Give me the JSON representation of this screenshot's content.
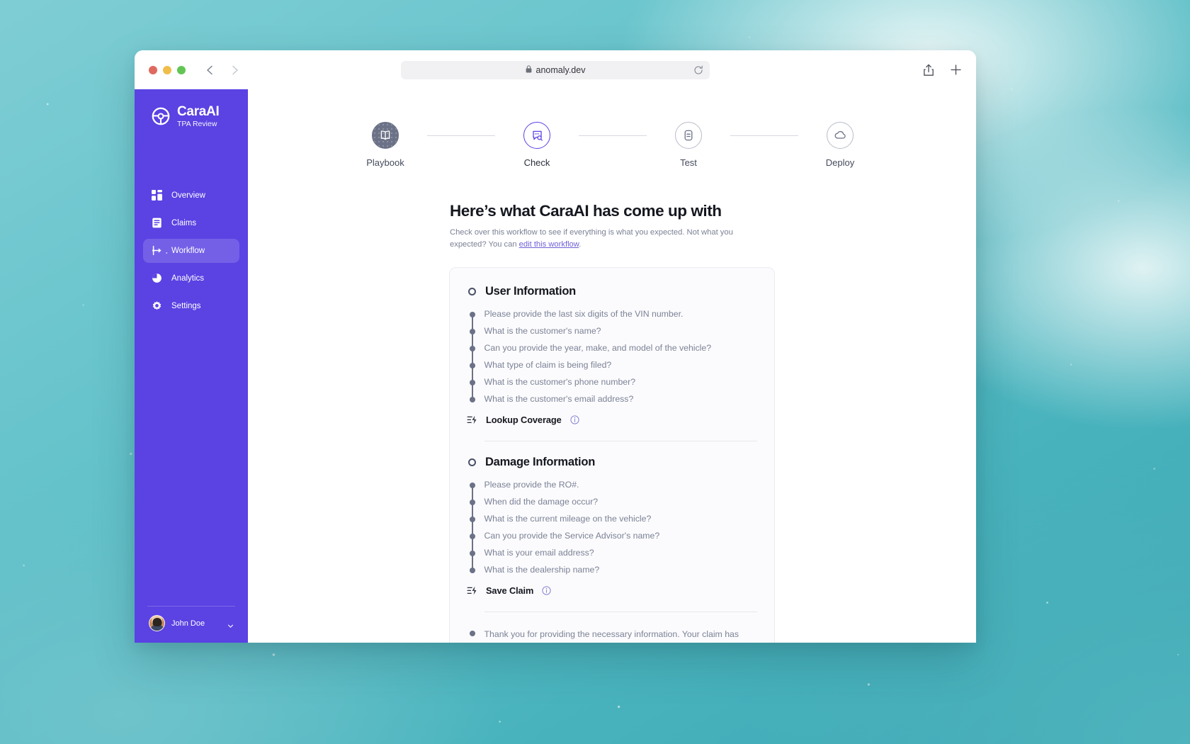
{
  "browser": {
    "url": "anomaly.dev",
    "lock_icon": "lock-icon",
    "reload_icon": "reload-icon",
    "back_icon": "chevron-left-icon",
    "forward_icon": "chevron-right-icon",
    "share_icon": "share-icon",
    "new_tab_icon": "plus-icon"
  },
  "sidebar": {
    "brand": {
      "title": "CaraAI",
      "subtitle": "TPA Review",
      "logo_icon": "steering-wheel-icon"
    },
    "items": [
      {
        "label": "Overview",
        "icon": "grid-icon",
        "active": false
      },
      {
        "label": "Claims",
        "icon": "document-icon",
        "active": false
      },
      {
        "label": "Workflow",
        "icon": "workflow-icon",
        "active": true
      },
      {
        "label": "Analytics",
        "icon": "pie-chart-icon",
        "active": false
      },
      {
        "label": "Settings",
        "icon": "gear-icon",
        "active": false
      }
    ],
    "user": {
      "name": "John Doe",
      "caret_icon": "chevron-down-icon"
    },
    "accent": "#5A42E3"
  },
  "stepper": {
    "steps": [
      {
        "label": "Playbook",
        "icon": "book-icon",
        "state": "done"
      },
      {
        "label": "Check",
        "icon": "chat-search-icon",
        "state": "current"
      },
      {
        "label": "Test",
        "icon": "test-doc-icon",
        "state": "upcoming"
      },
      {
        "label": "Deploy",
        "icon": "cloud-icon",
        "state": "upcoming"
      }
    ],
    "current_color": "#5A42E3",
    "done_color": "#6b7186"
  },
  "main": {
    "title": "Here’s what CaraAI has come up with",
    "subtitle_before": "Check over this workflow to see if everything is what you expected. Not what you expected? You can ",
    "subtitle_link": "edit this workflow",
    "subtitle_after": "."
  },
  "workflow": {
    "sections": [
      {
        "title": "User Information",
        "steps": [
          "Please provide the last six digits of the VIN number.",
          "What is the customer's name?",
          "Can you provide the year, make, and model of the vehicle?",
          "What type of claim is being filed?",
          "What is the customer's phone number?",
          "What is the customer's email address?"
        ],
        "action": {
          "label": "Lookup Coverage",
          "icon": "action-bolt-icon",
          "info_icon": "info-icon"
        }
      },
      {
        "title": "Damage Information",
        "steps": [
          "Please provide the RO#.",
          "When did the damage occur?",
          "What is the current mileage on the vehicle?",
          "Can you provide the Service Advisor's name?",
          "What is your email address?",
          "What is the dealership name?"
        ],
        "action": {
          "label": "Save Claim",
          "icon": "action-bolt-icon",
          "info_icon": "info-icon"
        }
      }
    ],
    "final_message": "Thank you for providing the necessary information. Your claim has been saved and will be reviewed by a claims specialist for"
  }
}
